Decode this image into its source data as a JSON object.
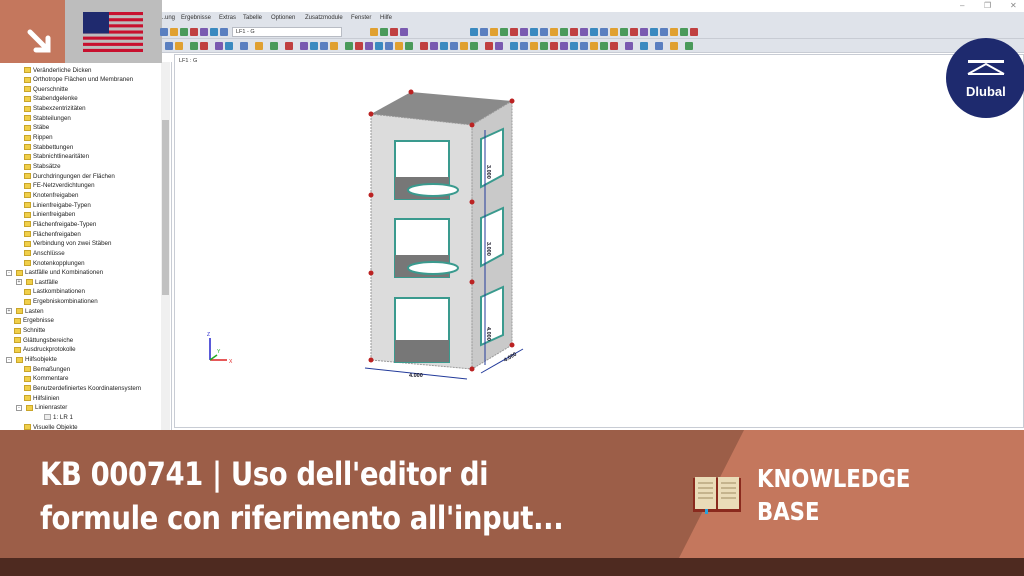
{
  "menu": [
    "...ung",
    "Ergebnisse",
    "Extras",
    "Tabelle",
    "Optionen",
    "Zusatzmodule",
    "Fenster",
    "Hilfe"
  ],
  "toolbar": {
    "loadcase_combo": "LF1 - G"
  },
  "viewport": {
    "label": "LF1 : G",
    "dims": [
      "3.000",
      "3.000",
      "4.000",
      "4.000",
      "4.000"
    ],
    "axes": {
      "x": "X",
      "y": "Y",
      "z": "Z"
    }
  },
  "tree": [
    {
      "label": "Veränderliche Dicken",
      "level": 2
    },
    {
      "label": "Orthotrope Flächen und Membranen",
      "level": 2
    },
    {
      "label": "Querschnitte",
      "level": 2
    },
    {
      "label": "Stabendgelenke",
      "level": 2
    },
    {
      "label": "Stabexzentrizitäten",
      "level": 2
    },
    {
      "label": "Stabteilungen",
      "level": 2
    },
    {
      "label": "Stäbe",
      "level": 2
    },
    {
      "label": "Rippen",
      "level": 2
    },
    {
      "label": "Stabbettungen",
      "level": 2
    },
    {
      "label": "Stabnichtlinearitäten",
      "level": 2
    },
    {
      "label": "Stabsätze",
      "level": 2
    },
    {
      "label": "Durchdringungen der Flächen",
      "level": 2
    },
    {
      "label": "FE-Netzverdichtungen",
      "level": 2
    },
    {
      "label": "Knotenfreigaben",
      "level": 2
    },
    {
      "label": "Linienfreigabe-Typen",
      "level": 2
    },
    {
      "label": "Linienfreigaben",
      "level": 2
    },
    {
      "label": "Flächenfreigabe-Typen",
      "level": 2
    },
    {
      "label": "Flächenfreigaben",
      "level": 2
    },
    {
      "label": "Verbindung von zwei Stäben",
      "level": 2
    },
    {
      "label": "Anschlüsse",
      "level": 2
    },
    {
      "label": "Knotenkopplungen",
      "level": 2
    },
    {
      "label": "Lastfälle und Kombinationen",
      "level": 1,
      "expand": "-"
    },
    {
      "label": "Lastfälle",
      "level": 2,
      "expand": "+"
    },
    {
      "label": "Lastkombinationen",
      "level": 2
    },
    {
      "label": "Ergebniskombinationen",
      "level": 2
    },
    {
      "label": "Lasten",
      "level": 1,
      "expand": "+"
    },
    {
      "label": "Ergebnisse",
      "level": 1
    },
    {
      "label": "Schnitte",
      "level": 1
    },
    {
      "label": "Glättungsbereiche",
      "level": 1
    },
    {
      "label": "Ausdruckprotokolle",
      "level": 1
    },
    {
      "label": "Hilfsobjekte",
      "level": 1,
      "expand": "-"
    },
    {
      "label": "Bemaßungen",
      "level": 2
    },
    {
      "label": "Kommentare",
      "level": 2
    },
    {
      "label": "Benutzerdefiniertes Koordinatensystem",
      "level": 2
    },
    {
      "label": "Hilfslinien",
      "level": 2
    },
    {
      "label": "Linienraster",
      "level": 2,
      "expand": "-"
    },
    {
      "label": "1: LR 1",
      "level": 3
    },
    {
      "label": "Visuelle Objekte",
      "level": 2
    }
  ],
  "banner": {
    "title_line1": "KB 000741 | Uso dell'editor di",
    "title_line2": "formule con riferimento all'input...",
    "kb_line1": "KNOWLEDGE",
    "kb_line2": "BASE"
  },
  "brand": {
    "logo_text": "Dlubal",
    "accent": "#c4775d",
    "dark": "#9c5e48",
    "navy": "#1e2a6e"
  }
}
